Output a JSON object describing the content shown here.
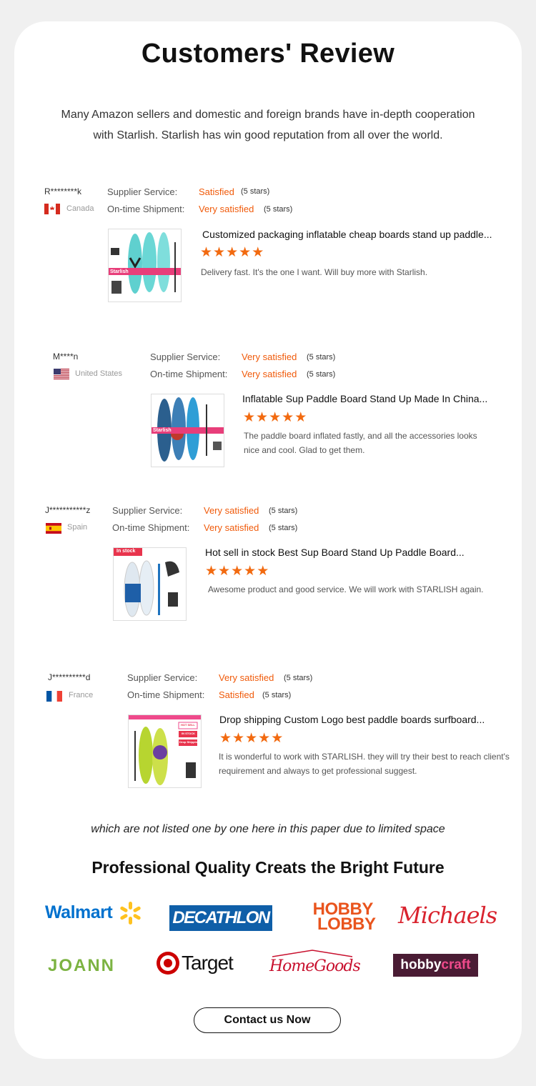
{
  "header": {
    "title": "Customers' Review",
    "intro_line1": "Many Amazon sellers and domestic and foreign brands have in-depth cooperation",
    "intro_line2": "with Starlish. Starlish has win good reputation from all over the world."
  },
  "labels": {
    "supplier_service": "Supplier Service:",
    "ontime_shipment": "On-time Shipment:"
  },
  "reviews": [
    {
      "name": "R********k",
      "country": "Canada",
      "supplier_value": "Satisfied",
      "supplier_stars": "(5 stars)",
      "shipment_value": "Very satisfied",
      "shipment_stars": "(5 stars)",
      "product": "Customized packaging inflatable cheap boards stand up paddle...",
      "rating": 5,
      "review": "Delivery fast. It's the one I want. Will buy more with Starlish.",
      "thumb_label": "Starlish"
    },
    {
      "name": "M****n",
      "country": "United States",
      "supplier_value": "Very satisfied",
      "supplier_stars": "(5 stars)",
      "shipment_value": "Very satisfied",
      "shipment_stars": "(5 stars)",
      "product": "Inflatable Sup Paddle Board Stand Up Made In China...",
      "rating": 5,
      "review": "The paddle board inflated fastly, and all the accessories looks nice and cool. Glad to get them.",
      "thumb_label": "Starlish"
    },
    {
      "name": "J***********z",
      "country": "Spain",
      "supplier_value": "Very satisfied",
      "supplier_stars": "(5 stars)",
      "shipment_value": "Very satisfied",
      "shipment_stars": "(5 stars)",
      "product": "Hot sell in stock Best Sup Board Stand Up Paddle Board...",
      "rating": 5,
      "review": "Awesome product and good service. We will work with STARLISH again.",
      "thumb_label": "In stock"
    },
    {
      "name": "J**********d",
      "country": "France",
      "supplier_value": "Very satisfied",
      "supplier_stars": "(5 stars)",
      "shipment_value": "Satisfied",
      "shipment_stars": "(5 stars)",
      "product": "Drop shipping Custom Logo best paddle boards surfboard...",
      "rating": 5,
      "review": "It is wonderful to work with STARLISH. they will try their best to reach client's requirement and always to get professional suggest.",
      "thumb_tags": [
        "HOT SELL",
        "IN STOCK",
        "Drop Shipping"
      ]
    }
  ],
  "footnote": "which are not listed one by one here in this paper due to limited space",
  "partners": {
    "title": "Professional Quality Creats the Bright Future",
    "walmart": "Walmart",
    "decathlon": "DECATHLON",
    "hobbylobby_line1": "HOBBY",
    "hobbylobby_line2": "LOBBY",
    "michaels": "Michaels",
    "joann": "JOANN",
    "target": "Target",
    "homegoods": "HomeGoods",
    "hobbycraft_a": "hobby",
    "hobbycraft_b": "craft"
  },
  "cta": {
    "label": "Contact us Now"
  },
  "colors": {
    "accent_orange": "#f05a0a",
    "star_orange": "#f26a10",
    "walmart_blue": "#0071ce",
    "walmart_yellow": "#ffc220",
    "decathlon_blue": "#0f5fa8",
    "hobbylobby_orange": "#e9541d",
    "michaels_red": "#d9232e",
    "joann_green": "#7cb342",
    "target_red": "#cc0000",
    "homegoods_red": "#c8102e",
    "hobbycraft_bg": "#4a1c34",
    "hobbycraft_pink": "#ef4a8b"
  }
}
